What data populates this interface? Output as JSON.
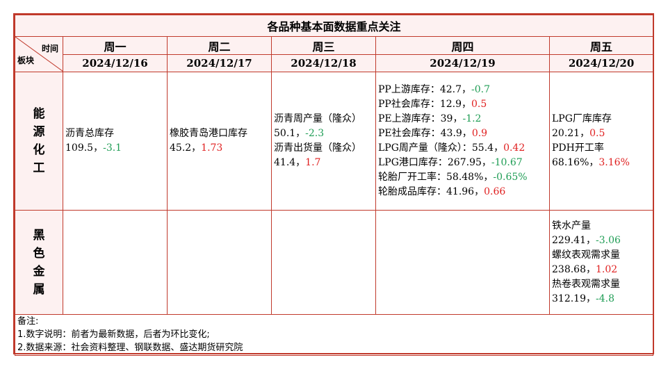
{
  "title": "各品种基本面数据重点关注",
  "corner": {
    "top": "时间",
    "bottom": "板块"
  },
  "days": [
    "周一",
    "周二",
    "周三",
    "周四",
    "周五"
  ],
  "dates": [
    "2024/12/16",
    "2024/12/17",
    "2024/12/18",
    "2024/12/19",
    "2024/12/20"
  ],
  "sectors": [
    {
      "chars": [
        "能",
        "源",
        "化",
        "工"
      ],
      "cells": [
        [
          {
            "name": "沥青总库存",
            "value": "109.5，",
            "change": "-3.1"
          }
        ],
        [
          {
            "name": "橡胶青岛港口库存",
            "value": "45.2，",
            "change": "1.73"
          }
        ],
        [
          {
            "name": "沥青周产量（隆众）",
            "value": "50.1，",
            "change": "-2.3"
          },
          {
            "name": "沥青出货量（隆众）",
            "value": "41.4，",
            "change": "1.7"
          }
        ],
        [
          {
            "inline": "PP上游库存：42.7，",
            "change": "-0.7"
          },
          {
            "inline": "PP社会库存：12.9，",
            "change": "0.5"
          },
          {
            "inline": "PE上游库存：39，",
            "change": "-1.2"
          },
          {
            "inline": "PE社会库存：43.9，",
            "change": "0.9"
          },
          {
            "inline": "LPG周产量（隆众）：55.4，",
            "change": "0.42"
          },
          {
            "inline": "LPG港口库存：267.95，",
            "change": "-10.67"
          },
          {
            "inline": "轮胎厂开工率：58.48%，",
            "change": "-0.65%"
          },
          {
            "inline": "轮胎成品库存：41.96，",
            "change": "0.66"
          }
        ],
        [
          {
            "name": "LPG厂库库存",
            "value": "20.21，",
            "change": "0.5"
          },
          {
            "name": "PDH开工率",
            "value": "68.16%，",
            "change": "3.16%"
          }
        ]
      ]
    },
    {
      "chars": [
        "黑",
        "色",
        "金",
        "属"
      ],
      "cells": [
        [],
        [],
        [],
        [],
        [
          {
            "name": "铁水产量",
            "value": "229.41，",
            "change": "-3.06"
          },
          {
            "name": "螺纹表观需求量",
            "value": "238.68，",
            "change": "1.02"
          },
          {
            "name": "热卷表观需求量",
            "value": "312.19，",
            "change": "-4.8"
          }
        ]
      ]
    }
  ],
  "notes": [
    "备注:",
    "1.数字说明：前者为最新数据，后者为环比变化;",
    "2.数据来源：社会资料整理、钢联数据、盛达期货研究院"
  ],
  "colors": {
    "border": "#c0392b",
    "up": "#e02020",
    "down": "#1f9d55",
    "header_bg": "#fdf1f1"
  }
}
